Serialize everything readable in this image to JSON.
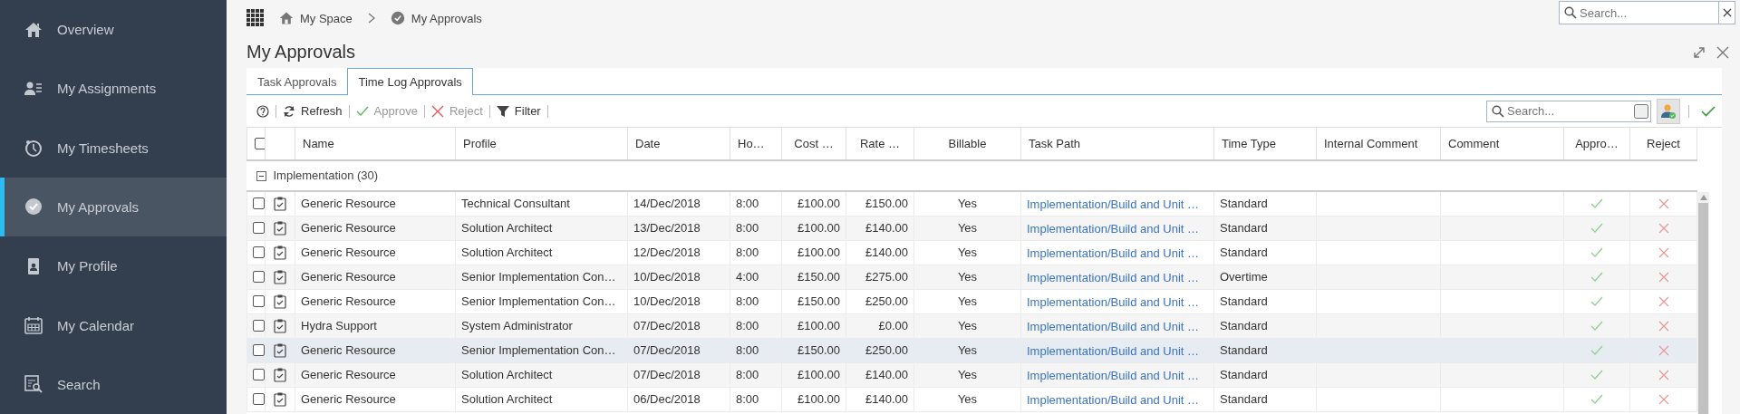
{
  "sidebar": {
    "items": [
      {
        "label": "Overview",
        "selected": false
      },
      {
        "label": "My Assignments",
        "selected": false
      },
      {
        "label": "My Timesheets",
        "selected": false
      },
      {
        "label": "My Approvals",
        "selected": true
      },
      {
        "label": "My Profile",
        "selected": false
      },
      {
        "label": "My Calendar",
        "selected": false
      },
      {
        "label": "Search",
        "selected": false
      }
    ]
  },
  "breadcrumb": [
    {
      "label": "My Space"
    },
    {
      "label": "My Approvals"
    }
  ],
  "global_search": {
    "placeholder": "Search..."
  },
  "page": {
    "title": "My Approvals"
  },
  "tabs": [
    {
      "label": "Task Approvals",
      "selected": false
    },
    {
      "label": "Time Log Approvals",
      "selected": true
    }
  ],
  "toolbar": [
    {
      "kind": "help"
    },
    {
      "kind": "refresh",
      "label": "Refresh",
      "disabled": false
    },
    {
      "kind": "approve",
      "label": "Approve",
      "disabled": true
    },
    {
      "kind": "reject",
      "label": "Reject",
      "disabled": true
    },
    {
      "kind": "filter",
      "label": "Filter",
      "disabled": false
    }
  ],
  "grid_search": {
    "placeholder": "Search..."
  },
  "table": {
    "select_all": {
      "checked": false
    },
    "columns": [
      {
        "kind": "check"
      },
      {
        "kind": "icon"
      },
      {
        "label": "Name"
      },
      {
        "label": "Profile"
      },
      {
        "label": "Date"
      },
      {
        "label": "Ho…"
      },
      {
        "label": "Cost …"
      },
      {
        "label": "Rate …"
      },
      {
        "label": "Billable"
      },
      {
        "label": "Task Path",
        "kind": "link"
      },
      {
        "label": "Time Type"
      },
      {
        "label": "Internal Comment"
      },
      {
        "label": "Comment"
      },
      {
        "label": "Appro…",
        "kind": "approve"
      },
      {
        "label": "Reject",
        "kind": "reject"
      }
    ],
    "group": {
      "label": "Implementation (30)",
      "expanded": true
    },
    "rows": [
      {
        "name": "Generic Resource",
        "profile": "Technical Consultant",
        "date": "14/Dec/2018",
        "hours": "8:00",
        "cost": "£100.00",
        "rate": "£150.00",
        "billable": "Yes",
        "task_path": "Implementation/Build and Unit …",
        "time_type": "Standard",
        "checked": false,
        "selected": false
      },
      {
        "name": "Generic Resource",
        "profile": "Solution Architect",
        "date": "13/Dec/2018",
        "hours": "8:00",
        "cost": "£100.00",
        "rate": "£140.00",
        "billable": "Yes",
        "task_path": "Implementation/Build and Unit …",
        "time_type": "Standard",
        "checked": false,
        "selected": false
      },
      {
        "name": "Generic Resource",
        "profile": "Solution Architect",
        "date": "12/Dec/2018",
        "hours": "8:00",
        "cost": "£100.00",
        "rate": "£140.00",
        "billable": "Yes",
        "task_path": "Implementation/Build and Unit …",
        "time_type": "Standard",
        "checked": false,
        "selected": false
      },
      {
        "name": "Generic Resource",
        "profile": "Senior Implementation Con…",
        "date": "10/Dec/2018",
        "hours": "4:00",
        "cost": "£150.00",
        "rate": "£275.00",
        "billable": "Yes",
        "task_path": "Implementation/Build and Unit …",
        "time_type": "Overtime",
        "checked": false,
        "selected": false
      },
      {
        "name": "Generic Resource",
        "profile": "Senior Implementation Con…",
        "date": "10/Dec/2018",
        "hours": "8:00",
        "cost": "£150.00",
        "rate": "£250.00",
        "billable": "Yes",
        "task_path": "Implementation/Build and Unit …",
        "time_type": "Standard",
        "checked": false,
        "selected": false
      },
      {
        "name": "Hydra Support",
        "profile": "System Administrator",
        "date": "07/Dec/2018",
        "hours": "8:00",
        "cost": "£100.00",
        "rate": "£0.00",
        "billable": "Yes",
        "task_path": "Implementation/Build and Unit …",
        "time_type": "Standard",
        "checked": false,
        "selected": false
      },
      {
        "name": "Generic Resource",
        "profile": "Senior Implementation Con…",
        "date": "07/Dec/2018",
        "hours": "8:00",
        "cost": "£150.00",
        "rate": "£250.00",
        "billable": "Yes",
        "task_path": "Implementation/Build and Unit …",
        "time_type": "Standard",
        "checked": false,
        "selected": true
      },
      {
        "name": "Generic Resource",
        "profile": "Solution Architect",
        "date": "07/Dec/2018",
        "hours": "8:00",
        "cost": "£100.00",
        "rate": "£140.00",
        "billable": "Yes",
        "task_path": "Implementation/Build and Unit …",
        "time_type": "Standard",
        "checked": false,
        "selected": false
      },
      {
        "name": "Generic Resource",
        "profile": "Solution Architect",
        "date": "06/Dec/2018",
        "hours": "8:00",
        "cost": "£100.00",
        "rate": "£140.00",
        "billable": "Yes",
        "task_path": "Implementation/Build and Unit …",
        "time_type": "Standard",
        "checked": false,
        "selected": false
      }
    ]
  }
}
